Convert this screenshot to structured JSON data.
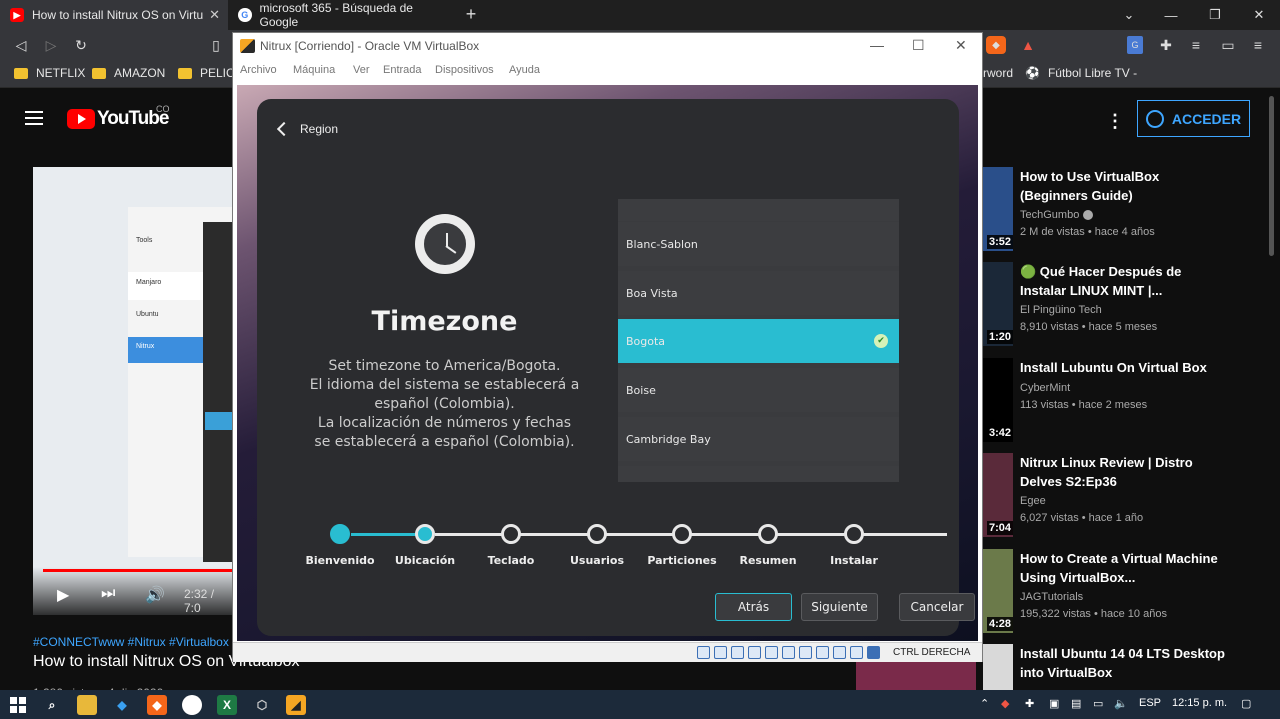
{
  "browser": {
    "tabs": [
      {
        "title": "How to install Nitrux OS on Virtu"
      },
      {
        "title": "microsoft 365 - Búsqueda de Google"
      }
    ],
    "bookmarks": [
      "NETFLIX",
      "AMAZON",
      "PELICU",
      "rword",
      "Fútbol Libre TV -"
    ]
  },
  "youtube": {
    "logo": "YouTube",
    "country": "CO",
    "sign_in": "ACCEDER",
    "player": {
      "time": "2:32 / 7:0",
      "progress": 0.35,
      "inner_items": [
        "Tools",
        "Manjaro",
        "Ubuntu",
        "Nitrux"
      ]
    },
    "hashtags": "#CONNECTwww #Nitrux #Virtualbox",
    "title": "How to install Nitrux OS on Virtualbox",
    "meta": "1,280 vistas • 4 dic 2020",
    "recommendations": [
      {
        "title": "How to Use VirtualBox (Beginners Guide)",
        "channel": "TechGumbo",
        "verified": true,
        "views": "2 M de vistas • hace 4 años",
        "duration": "3:52"
      },
      {
        "title": "🟢 Qué Hacer Después de Instalar LINUX MINT |...",
        "channel": "El Pingüino Tech",
        "verified": false,
        "views": "8,910 vistas • hace 5 meses",
        "duration": "1:20"
      },
      {
        "title": "Install Lubuntu On Virtual Box",
        "channel": "CyberMint",
        "verified": false,
        "views": "113 vistas • hace 2 meses",
        "duration": "3:42"
      },
      {
        "title": "Nitrux Linux Review | Distro Delves S2:Ep36",
        "channel": "Egee",
        "verified": false,
        "views": "6,027 vistas • hace 1 año",
        "duration": "7:04"
      },
      {
        "title": "How to Create a Virtual Machine Using VirtualBox...",
        "channel": "JAGTutorials",
        "verified": false,
        "views": "195,322 vistas • hace 10 años",
        "duration": "4:28"
      },
      {
        "title": "Install Ubuntu 14 04 LTS Desktop into VirtualBox",
        "channel": "",
        "verified": false,
        "views": "",
        "duration": ""
      }
    ]
  },
  "vbox": {
    "title": "Nitrux [Corriendo] - Oracle VM VirtualBox",
    "menu": [
      "Archivo",
      "Máquina",
      "Ver",
      "Entrada",
      "Dispositivos",
      "Ayuda"
    ],
    "host_key": "CTRL DERECHA"
  },
  "installer": {
    "back_link": "Region",
    "heading": "Timezone",
    "description": [
      "Set timezone to America/Bogota.",
      "El idioma del sistema se establecerá a",
      "español (Colombia).",
      "La localización de números y fechas",
      "se establecerá a español (Colombia)."
    ],
    "timezones": [
      {
        "name": "Blanc-Sablon",
        "selected": false
      },
      {
        "name": "Boa Vista",
        "selected": false
      },
      {
        "name": "Bogota",
        "selected": true
      },
      {
        "name": "Boise",
        "selected": false
      },
      {
        "name": "Cambridge Bay",
        "selected": false
      }
    ],
    "steps": [
      {
        "label": "Bienvenido",
        "state": "done"
      },
      {
        "label": "Ubicación",
        "state": "current"
      },
      {
        "label": "Teclado",
        "state": "todo"
      },
      {
        "label": "Usuarios",
        "state": "todo"
      },
      {
        "label": "Particiones",
        "state": "todo"
      },
      {
        "label": "Resumen",
        "state": "todo"
      },
      {
        "label": "Instalar",
        "state": "todo"
      }
    ],
    "buttons": {
      "back": "Atrás",
      "next": "Siguiente",
      "cancel": "Cancelar"
    }
  },
  "taskbar": {
    "lang": "ESP",
    "clock": "12:15 p. m."
  },
  "colors": {
    "accent": "#29bdd1",
    "youtube_red": "#ff0000",
    "link_blue": "#3ea6ff"
  }
}
